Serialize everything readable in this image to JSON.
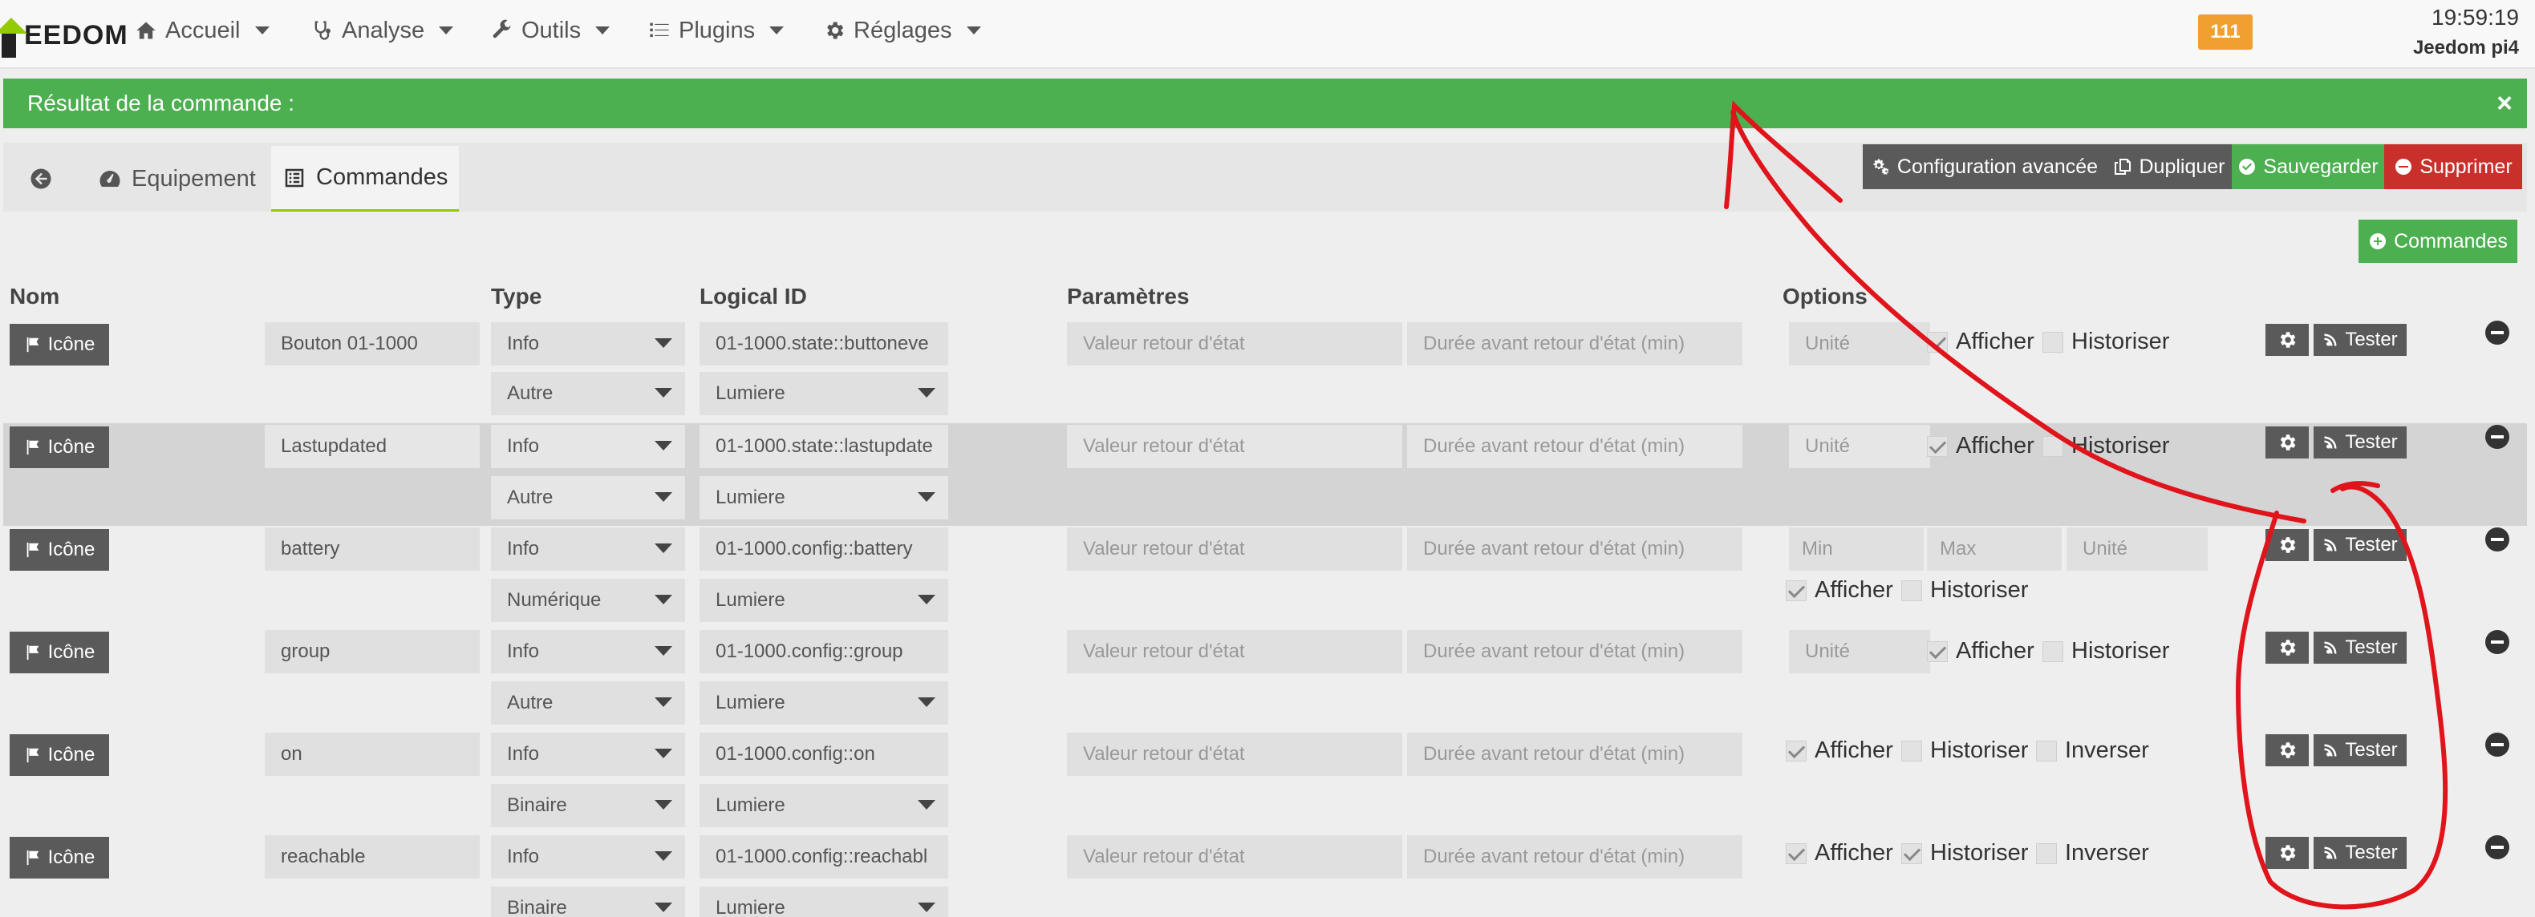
{
  "navbar": {
    "logo_text": "EEDOM",
    "menus": [
      {
        "label": "Accueil",
        "icon": "home-icon"
      },
      {
        "label": "Analyse",
        "icon": "stethoscope-icon"
      },
      {
        "label": "Outils",
        "icon": "wrench-icon"
      },
      {
        "label": "Plugins",
        "icon": "list-icon"
      },
      {
        "label": "Réglages",
        "icon": "gear-icon"
      }
    ],
    "notification_count": "111",
    "time": "19:59:19",
    "host": "Jeedom pi4"
  },
  "alert": {
    "text": "Résultat de la commande :",
    "close": "×",
    "color": "#4caf50"
  },
  "tabs": [
    {
      "label": "",
      "icon": "arrow-left-circle-icon"
    },
    {
      "label": "Equipement",
      "icon": "tachometer-icon"
    },
    {
      "label": "Commandes",
      "icon": "list-alt-icon",
      "active": true
    }
  ],
  "actions": {
    "config": "Configuration avancée",
    "duplicate": "Dupliquer",
    "save": "Sauvegarder",
    "delete": "Supprimer",
    "add_commands": "Commandes"
  },
  "headers": {
    "nom": "Nom",
    "type": "Type",
    "logical_id": "Logical ID",
    "parametres": "Paramètres",
    "options": "Options"
  },
  "common": {
    "icone": "Icône",
    "valeur_retour": "Valeur retour d'état",
    "duree_retour": "Durée avant retour d'état (min)",
    "unite": "Unité",
    "min": "Min",
    "max": "Max",
    "afficher": "Afficher",
    "historiser": "Historiser",
    "inverser": "Inverser",
    "tester": "Tester"
  },
  "rows": [
    {
      "name": "Bouton 01-1000",
      "type": "Info",
      "subtype": "Autre",
      "logical_id": "01-1000.state::buttoneve",
      "generic": "Lumiere",
      "afficher": true,
      "historiser": false
    },
    {
      "name": "Lastupdated",
      "type": "Info",
      "subtype": "Autre",
      "logical_id": "01-1000.state::lastupdate",
      "generic": "Lumiere",
      "afficher": true,
      "historiser": false
    },
    {
      "name": "battery",
      "type": "Info",
      "subtype": "Numérique",
      "logical_id": "01-1000.config::battery",
      "generic": "Lumiere",
      "afficher": true,
      "historiser": false
    },
    {
      "name": "group",
      "type": "Info",
      "subtype": "Autre",
      "logical_id": "01-1000.config::group",
      "generic": "Lumiere",
      "afficher": true,
      "historiser": false
    },
    {
      "name": "on",
      "type": "Info",
      "subtype": "Binaire",
      "logical_id": "01-1000.config::on",
      "generic": "Lumiere",
      "afficher": true,
      "historiser": false,
      "inverser": false
    },
    {
      "name": "reachable",
      "type": "Info",
      "subtype": "Binaire",
      "logical_id": "01-1000.config::reachabl",
      "generic": "Lumiere",
      "afficher": true,
      "historiser": true,
      "inverser": false
    }
  ],
  "annotation_color": "#e0141b"
}
